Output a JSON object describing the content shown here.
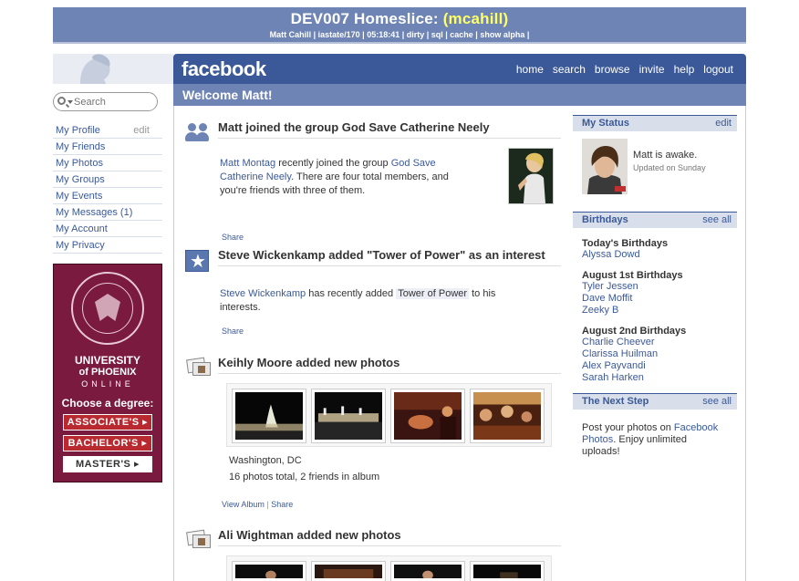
{
  "dev_banner": {
    "title_prefix": "DEV007 Homeslice: ",
    "title_user": "(mcahill)",
    "status_line": "Matt Cahill | iastate/170 | 05:18:41 | dirty | sql | cache | show alpha |"
  },
  "search": {
    "placeholder": "Search"
  },
  "left_nav": {
    "items": [
      {
        "label": "My Profile",
        "extra": "edit"
      },
      {
        "label": "My Friends"
      },
      {
        "label": "My Photos"
      },
      {
        "label": "My Groups"
      },
      {
        "label": "My Events"
      },
      {
        "label": "My Messages (1)"
      },
      {
        "label": "My Account"
      },
      {
        "label": "My Privacy"
      }
    ]
  },
  "ad": {
    "seal_text": "UNIVERSITY OF PHOENIX",
    "line1": "UNIVERSITY",
    "line2": "of PHOENIX",
    "line3": "ONLINE",
    "choose": "Choose a degree:",
    "buttons": [
      "ASSOCIATE'S ▸",
      "BACHELOR'S ▸",
      "MASTER'S ▸"
    ]
  },
  "header": {
    "logo": "facebook",
    "nav": [
      "home",
      "search",
      "browse",
      "invite",
      "help",
      "logout"
    ],
    "welcome": "Welcome Matt!"
  },
  "feed": [
    {
      "title": "Matt joined the group God Save Catherine Neely",
      "actor": "Matt Montag",
      "t1": " recently joined the group ",
      "group": "God Save Catherine Neely",
      "t2": ". There are four total members, and you're friends with three of them.",
      "actions": [
        "Share"
      ]
    },
    {
      "title": "Steve Wickenkamp added \"Tower of Power\" as an interest",
      "actor": "Steve Wickenkamp",
      "t1": " has recently added ",
      "interest": "Tower of Power",
      "t2": " to his interests.",
      "actions": [
        "Share"
      ]
    },
    {
      "title": "Keihly Moore added new photos",
      "location": "Washington, DC",
      "summary": "16 photos total, 2 friends in album",
      "actions": [
        "View Album",
        "Share"
      ]
    },
    {
      "title": "Ali Wightman added new photos"
    }
  ],
  "status": {
    "header": "My Status",
    "edit": "edit",
    "text": "Matt is awake.",
    "updated": "Updated on Sunday"
  },
  "birthdays": {
    "header": "Birthdays",
    "see_all": "see all",
    "groups": [
      {
        "label": "Today's Birthdays",
        "names": [
          "Alyssa Dowd"
        ]
      },
      {
        "label": "August 1st Birthdays",
        "names": [
          "Tyler Jessen",
          "Dave Moffit",
          "Zeeky B"
        ]
      },
      {
        "label": "August 2nd Birthdays",
        "names": [
          "Charlie Cheever",
          "Clarissa Huilman",
          "Alex Payvandi",
          "Sarah Harken"
        ]
      }
    ]
  },
  "next_step": {
    "header": "The Next Step",
    "see_all": "see all",
    "t1": "Post your photos on ",
    "link": "Facebook Photos",
    "t2": ". Enjoy unlimited uploads!"
  },
  "colors": {
    "fb_blue": "#3b5998",
    "fb_light_blue": "#6d84b4",
    "box_header": "#d8dfea",
    "ad_maroon": "#7a1a3e"
  }
}
